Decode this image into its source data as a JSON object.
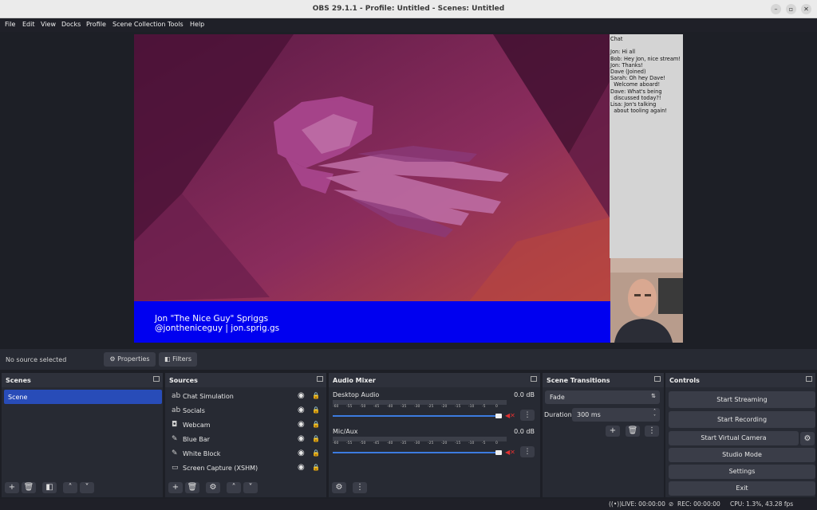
{
  "window": {
    "title": "OBS 29.1.1 - Profile: Untitled - Scenes: Untitled"
  },
  "menu": [
    "File",
    "Edit",
    "View",
    "Docks",
    "Profile",
    "Scene Collection",
    "Tools",
    "Help"
  ],
  "preview": {
    "chat_text": "Chat\n\nJon: Hi all\nBob: Hey Jon, nice stream!\nJon: Thanks!\nDave (Joined)\nSarah: Oh hey Dave!\n  Welcome aboard!\nDave: What's being\n  discussed today?!\nLisa: Jon's talking\n  about tooling again!",
    "banner_line1": "Jon \"The Nice Guy\" Spriggs",
    "banner_line2": "@jontheniceguy | jon.sprig.gs"
  },
  "source_bar": {
    "no_source": "No source selected",
    "properties": "Properties",
    "filters": "Filters"
  },
  "scenes": {
    "title": "Scenes",
    "items": [
      "Scene"
    ]
  },
  "sources": {
    "title": "Sources",
    "items": [
      {
        "name": "Chat Simulation",
        "icon": "text-icon"
      },
      {
        "name": "Socials",
        "icon": "text-icon"
      },
      {
        "name": "Webcam",
        "icon": "camera-icon"
      },
      {
        "name": "Blue Bar",
        "icon": "brush-icon"
      },
      {
        "name": "White Block",
        "icon": "brush-icon"
      },
      {
        "name": "Screen Capture (XSHM)",
        "icon": "monitor-icon"
      }
    ]
  },
  "mixer": {
    "title": "Audio Mixer",
    "ticks": [
      "-60",
      "-55",
      "-50",
      "-45",
      "-40",
      "-35",
      "-30",
      "-25",
      "-20",
      "-15",
      "-10",
      "-5",
      "0"
    ],
    "channels": [
      {
        "name": "Desktop Audio",
        "db": "0.0 dB",
        "volume": 1.0
      },
      {
        "name": "Mic/Aux",
        "db": "0.0 dB",
        "volume": 1.0
      }
    ]
  },
  "transitions": {
    "title": "Scene Transitions",
    "selected": "Fade",
    "duration_label": "Duration",
    "duration_value": "300 ms"
  },
  "controls": {
    "title": "Controls",
    "buttons": [
      "Start Streaming",
      "Start Recording",
      "Start Virtual Camera",
      "Studio Mode",
      "Settings",
      "Exit"
    ]
  },
  "status": {
    "live": "LIVE: 00:00:00",
    "rec": "REC: 00:00:00",
    "cpu": "CPU: 1.3%, 43.28 fps"
  }
}
